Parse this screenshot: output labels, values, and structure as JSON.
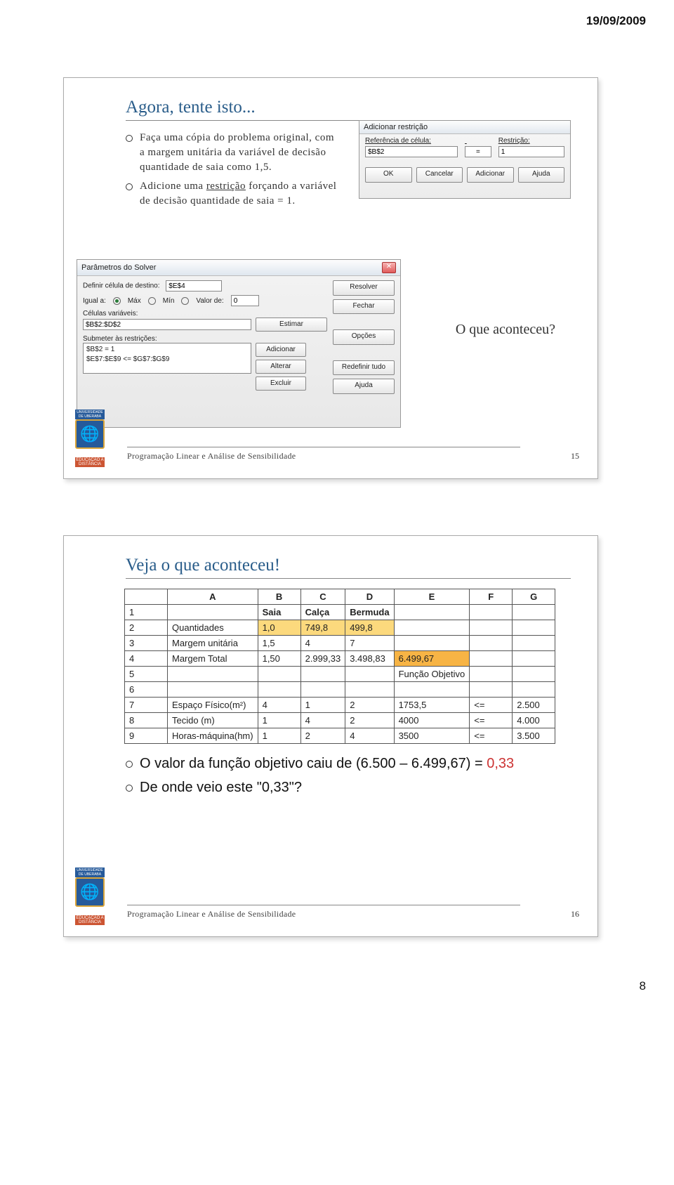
{
  "doc": {
    "date": "19/09/2009",
    "page_number": "8"
  },
  "slide1": {
    "title": "Agora, tente isto...",
    "bullets": [
      "Faça uma cópia do problema original, com a margem unitária da variável de decisão quantidade de saia como 1,5.",
      "Adicione uma restrição forçando a variável de decisão quantidade de saia = 1."
    ],
    "mid_question": "O que aconteceu?",
    "footer": "Programação Linear e Análise de Sensibilidade",
    "page": "15",
    "add_restriction_dialog": {
      "title": "Adicionar restrição",
      "cell_ref_label": "Referência de célula:",
      "cell_ref_value": "$B$2",
      "op": "=",
      "restriction_label": "Restrição:",
      "restriction_value": "1",
      "buttons": [
        "OK",
        "Cancelar",
        "Adicionar",
        "Ajuda"
      ]
    },
    "solver_dialog": {
      "title": "Parâmetros do Solver",
      "destino_label": "Definir célula de destino:",
      "destino_value": "$E$4",
      "igual_label": "Igual a:",
      "opt_max": "Máx",
      "opt_min": "Mín",
      "opt_valor": "Valor de:",
      "valor_value": "0",
      "celvar_label": "Células variáveis:",
      "celvar_value": "$B$2:$D$2",
      "estimar": "Estimar",
      "submeter_label": "Submeter às restrições:",
      "restrictions": [
        "$B$2 = 1",
        "$E$7:$E$9 <= $G$7:$G$9"
      ],
      "mini_buttons": [
        "Adicionar",
        "Alterar",
        "Excluir"
      ],
      "right_buttons": [
        "Resolver",
        "Fechar",
        "Opções",
        "Redefinir tudo",
        "Ajuda"
      ]
    }
  },
  "slide2": {
    "title": "Veja o que aconteceu!",
    "footer": "Programação Linear e Análise de Sensibilidade",
    "page": "16",
    "bullets": [
      "O valor da função objetivo caiu de (6.500 – 6.499,67) = 0,33",
      "De onde veio este \"0,33\"?"
    ],
    "table": {
      "cols": [
        "",
        "A",
        "B",
        "C",
        "D",
        "E",
        "F",
        "G"
      ],
      "rows": [
        {
          "n": "1",
          "cells": [
            "",
            "Saia",
            "Calça",
            "Bermuda",
            "",
            "",
            ""
          ]
        },
        {
          "n": "2",
          "cells": [
            "Quantidades",
            "1,0",
            "749,8",
            "499,8",
            "",
            "",
            ""
          ]
        },
        {
          "n": "3",
          "cells": [
            "Margem unitária",
            "1,5",
            "4",
            "7",
            "",
            "",
            ""
          ]
        },
        {
          "n": "4",
          "cells": [
            "Margem Total",
            "1,50",
            "2.999,33",
            "3.498,83",
            "6.499,67",
            "",
            ""
          ]
        },
        {
          "n": "5",
          "cells": [
            "",
            "",
            "",
            "",
            "Função Objetivo",
            "",
            ""
          ]
        },
        {
          "n": "6",
          "cells": [
            "",
            "",
            "",
            "",
            "",
            "",
            ""
          ]
        },
        {
          "n": "7",
          "cells": [
            "Espaço Físico(m²)",
            "4",
            "1",
            "2",
            "1753,5",
            "<=",
            "2.500"
          ]
        },
        {
          "n": "8",
          "cells": [
            "Tecido (m)",
            "1",
            "4",
            "2",
            "4000",
            "<=",
            "4.000"
          ]
        },
        {
          "n": "9",
          "cells": [
            "Horas-máquina(hm)",
            "1",
            "2",
            "4",
            "3500",
            "<=",
            "3.500"
          ]
        }
      ]
    }
  }
}
